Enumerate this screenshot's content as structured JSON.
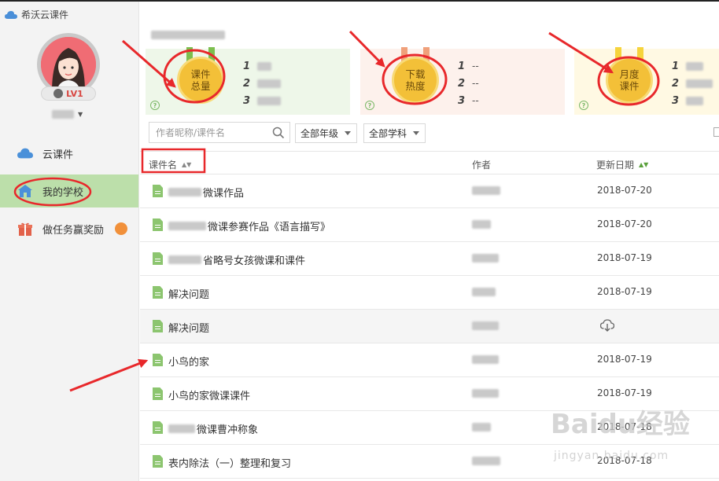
{
  "app": {
    "title": "希沃云课件"
  },
  "profile": {
    "level": "LV1"
  },
  "sidebar": {
    "items": [
      {
        "label": "云课件",
        "icon": "cloud-icon"
      },
      {
        "label": "我的学校",
        "icon": "school-icon",
        "active": true
      },
      {
        "label": "做任务赢奖励",
        "icon": "gift-icon"
      }
    ]
  },
  "stats": {
    "total": {
      "title": "课件\n总量",
      "ranks": [
        "1",
        "2",
        "3"
      ],
      "values": [
        "",
        "",
        ""
      ]
    },
    "downloads": {
      "title": "下载\n热度",
      "ranks": [
        "1",
        "2",
        "3"
      ],
      "values": [
        "--",
        "--",
        "--"
      ]
    },
    "monthly": {
      "title": "月度\n课件",
      "ranks": [
        "1",
        "2",
        "3"
      ],
      "values": [
        "",
        "",
        ""
      ]
    }
  },
  "filters": {
    "search_placeholder": "作者昵称/课件名",
    "grade": "全部年级",
    "subject": "全部学科"
  },
  "table": {
    "headers": {
      "name": "课件名",
      "author": "作者",
      "date": "更新日期"
    },
    "rows": [
      {
        "name": "微课作品",
        "date": "2018-07-20"
      },
      {
        "name": "微课参赛作品《语言描写》",
        "date": "2018-07-20"
      },
      {
        "name": "省略号女孩微课和课件",
        "date": "2018-07-19"
      },
      {
        "name": "解决问题",
        "date": "2018-07-19"
      },
      {
        "name": "解决问题",
        "date": ""
      },
      {
        "name": "小鸟的家",
        "date": "2018-07-19"
      },
      {
        "name": "小鸟的家微课课件",
        "date": "2018-07-19"
      },
      {
        "name": "微课曹冲称象",
        "date": "2018-07-18"
      },
      {
        "name": "表内除法（一）整理和复习",
        "date": "2018-07-18"
      }
    ]
  },
  "watermark": {
    "text": "Baidu经验",
    "sub": "jingyan.baidu.com"
  },
  "colors": {
    "accent_green": "#8cc56f",
    "active_nav": "#bcdfaa",
    "annotation_red": "#e8282b",
    "medal_gold": "#f3c038"
  }
}
